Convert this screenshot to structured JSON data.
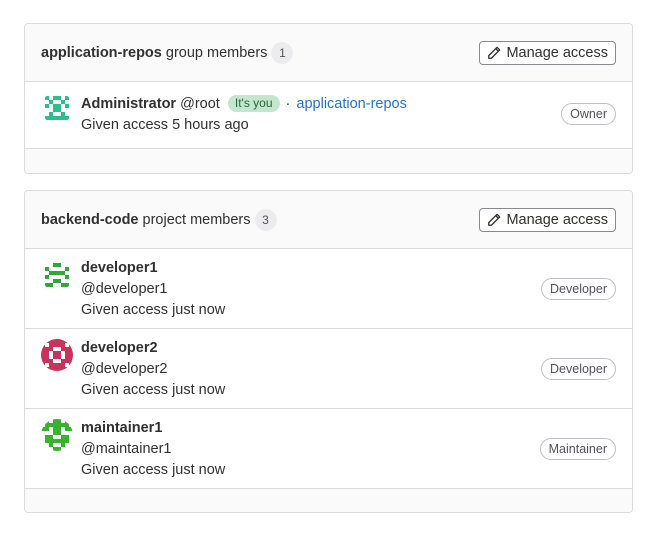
{
  "group_card": {
    "entity_name": "application-repos",
    "members_label": "group members",
    "count": "1",
    "manage_label": "Manage access",
    "members": [
      {
        "name": "Administrator",
        "username": "@root",
        "its_you": "It's you",
        "separator": "·",
        "source_link": "application-repos",
        "access": "Given access 5 hours ago",
        "role": "Owner"
      }
    ]
  },
  "project_card": {
    "entity_name": "backend-code",
    "members_label": "project members",
    "count": "3",
    "manage_label": "Manage access",
    "members": [
      {
        "name": "developer1",
        "username": "@developer1",
        "access": "Given access just now",
        "role": "Developer"
      },
      {
        "name": "developer2",
        "username": "@developer2",
        "access": "Given access just now",
        "role": "Developer"
      },
      {
        "name": "maintainer1",
        "username": "@maintainer1",
        "access": "Given access just now",
        "role": "Maintainer"
      }
    ]
  },
  "colors": {
    "link": "#1f75cb",
    "its_you_bg": "#c3e6cd",
    "avatar_admin": "#2bbf8a",
    "avatar_developer1": "#2fa83a",
    "avatar_developer2": "#c8335c",
    "avatar_maintainer1": "#34b52c"
  },
  "icons": {
    "manage": "pencil-icon",
    "avatars": [
      "identicon-avatar"
    ]
  }
}
